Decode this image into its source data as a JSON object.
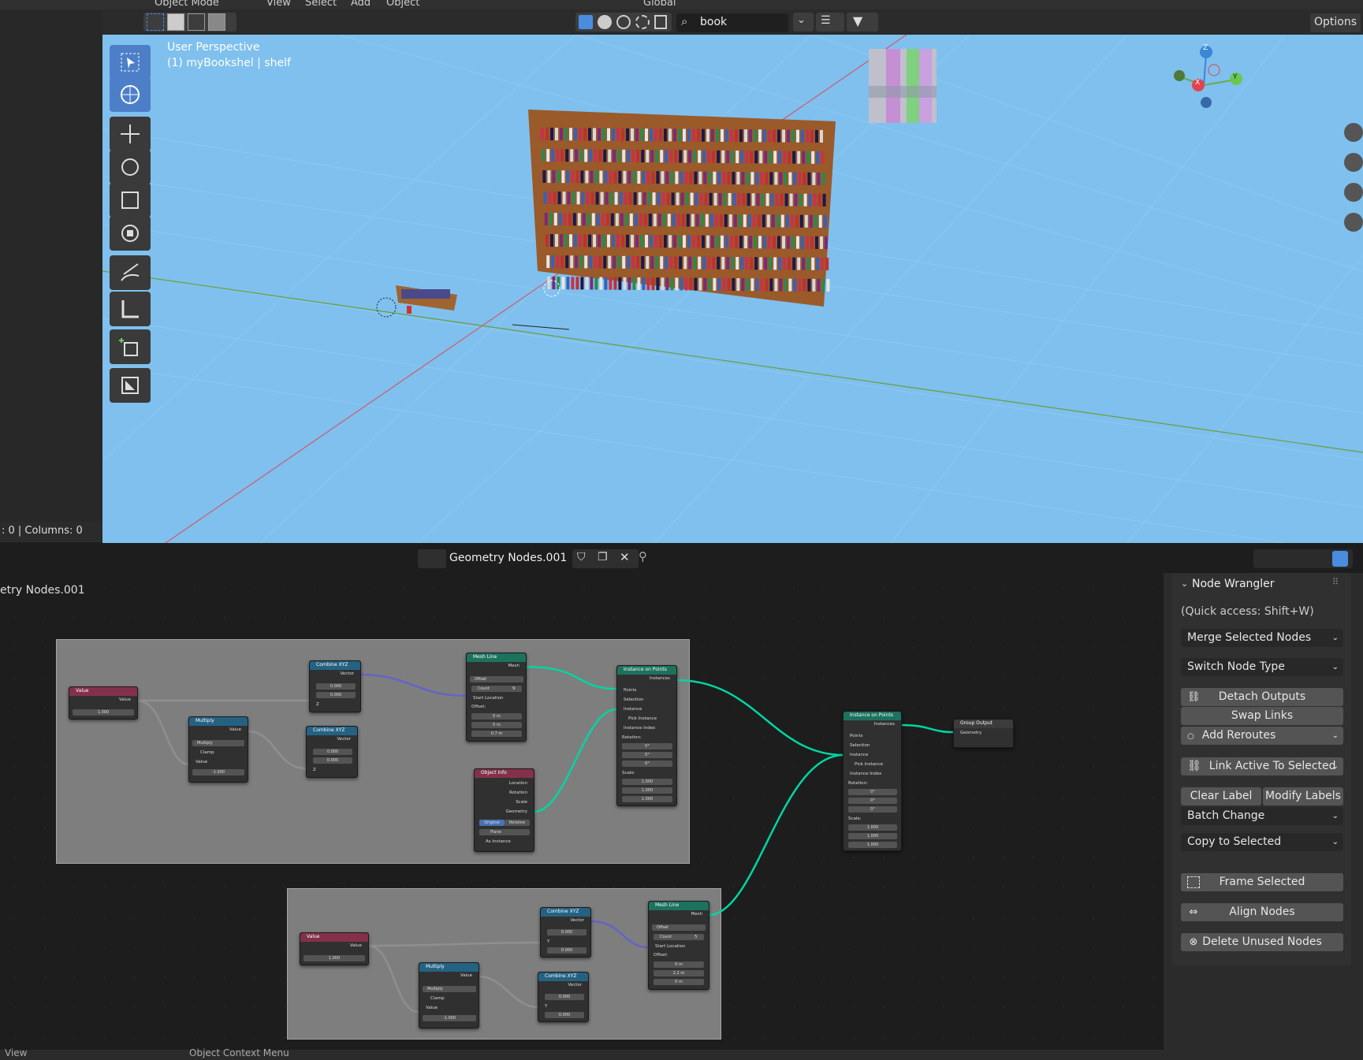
{
  "topbar": {
    "mode": "Object Mode",
    "menus": [
      "View",
      "Select",
      "Add",
      "Object"
    ],
    "orientation": "Global"
  },
  "viewport_header": {
    "search_value": "book",
    "options_label": "Options"
  },
  "viewport": {
    "perspective": "User Perspective",
    "object_info": "(1) myBookshel | shelf",
    "gizmo_axes": [
      "Z",
      "X",
      "Y"
    ]
  },
  "outliner_status": ": 0   |   Columns: 0",
  "node_editor": {
    "tree_name": "Geometry Nodes.001",
    "breadcrumb": "etry Nodes.001",
    "frame1": {
      "value_node": {
        "title": "Value",
        "out": "Value",
        "val": "1.000"
      },
      "multiply_node": {
        "title": "Multiply",
        "out": "Value",
        "op": "Multiply",
        "clamp": "Clamp",
        "in": "Value",
        "val_label": "Value",
        "val": "-1.000"
      },
      "combine1": {
        "title": "Combine XYZ",
        "out": "Vector",
        "x": "0.000",
        "y": "0.000",
        "z": "Z"
      },
      "combine2": {
        "title": "Combine XYZ",
        "out": "Vector",
        "x": "0.000",
        "y": "0.000",
        "z": "Z"
      },
      "meshline": {
        "title": "Mesh Line",
        "out": "Mesh",
        "mode": "Offset",
        "count_label": "Count",
        "count": "9",
        "start": "Start Location",
        "offset": "Offset:",
        "x": "0 m",
        "y": "0 m",
        "z": "0.7 m"
      },
      "objinfo": {
        "title": "Object Info",
        "outs": [
          "Location",
          "Rotation",
          "Scale",
          "Geometry"
        ],
        "original": "Original",
        "relative": "Relative",
        "object": "Plane",
        "as_instance": "As Instance"
      },
      "iop": {
        "title": "Instance on Points",
        "out": "Instances",
        "ins": [
          "Points",
          "Selection",
          "Instance",
          "Pick Instance",
          "Instance Index",
          "Rotation:"
        ],
        "rot": [
          "0°",
          "0°",
          "0°"
        ],
        "scale_label": "Scale:",
        "scale": [
          "1.000",
          "1.000",
          "1.000"
        ]
      }
    },
    "frame2": {
      "value_node": {
        "title": "Value",
        "out": "Value",
        "val": "1.000"
      },
      "multiply_node": {
        "title": "Multiply",
        "out": "Value",
        "op": "Multiply",
        "clamp": "Clamp",
        "in": "Value",
        "val_label": "Value",
        "val": "-1.000"
      },
      "combine1": {
        "title": "Combine XYZ",
        "out": "Vector",
        "x": "0.000",
        "y": "Y",
        "z": "0.000"
      },
      "combine2": {
        "title": "Combine XYZ",
        "out": "Vector",
        "x": "0.000",
        "y": "Y",
        "z": "0.000"
      },
      "meshline": {
        "title": "Mesh Line",
        "out": "Mesh",
        "mode": "Offset",
        "count_label": "Count",
        "count": "5",
        "start": "Start Location",
        "offset": "Offset:",
        "x": "0 m",
        "y": "2.2 m",
        "z": "0 m"
      }
    },
    "iop_main": {
      "title": "Instance on Points",
      "out": "Instances",
      "ins": [
        "Points",
        "Selection",
        "Instance",
        "Pick Instance",
        "Instance Index",
        "Rotation:"
      ],
      "rot": [
        "0°",
        "0°",
        "0°"
      ],
      "scale_label": "Scale:",
      "scale": [
        "1.000",
        "1.000",
        "1.000"
      ]
    },
    "group_output": {
      "title": "Group Output",
      "in": "Geometry"
    }
  },
  "sidebar": {
    "panel_title": "Node Wrangler",
    "quick_access": "(Quick access: Shift+W)",
    "merge": "Merge Selected Nodes",
    "switch": "Switch Node Type",
    "detach": "Detach Outputs",
    "swap": "Swap Links",
    "reroutes": "Add Reroutes",
    "link_active": "Link Active To Selected",
    "clear_label": "Clear Label",
    "modify_labels": "Modify Labels",
    "batch": "Batch Change",
    "copy": "Copy to Selected",
    "frame": "Frame Selected",
    "align": "Align Nodes",
    "delete": "Delete Unused Nodes"
  },
  "statusbar": {
    "left": "View",
    "mid": "Object Context Menu"
  }
}
